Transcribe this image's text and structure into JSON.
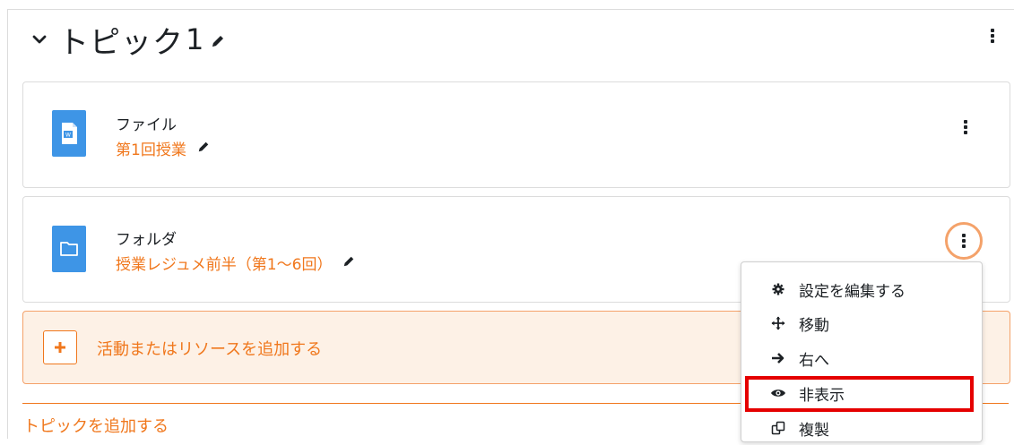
{
  "section": {
    "title": "トピック",
    "number": "1"
  },
  "activities": [
    {
      "type": "ファイル",
      "name": "第1回授業",
      "icon": "word-file-icon"
    },
    {
      "type": "フォルダ",
      "name": "授業レジュメ前半（第1〜6回）",
      "icon": "folder-icon"
    }
  ],
  "add_activity_label": "活動またはリソースを追加する",
  "add_topic_label": "トピックを追加する",
  "menu": {
    "items": [
      {
        "label": "設定を編集する",
        "icon": "gear-icon"
      },
      {
        "label": "移動",
        "icon": "move-icon"
      },
      {
        "label": "右へ",
        "icon": "arrow-right-icon"
      },
      {
        "label": "非表示",
        "icon": "eye-icon"
      },
      {
        "label": "複製",
        "icon": "copy-icon"
      }
    ]
  },
  "colors": {
    "accent": "#f0771c",
    "activity_icon_bg": "#3e95e6",
    "highlight": "#e50000"
  }
}
